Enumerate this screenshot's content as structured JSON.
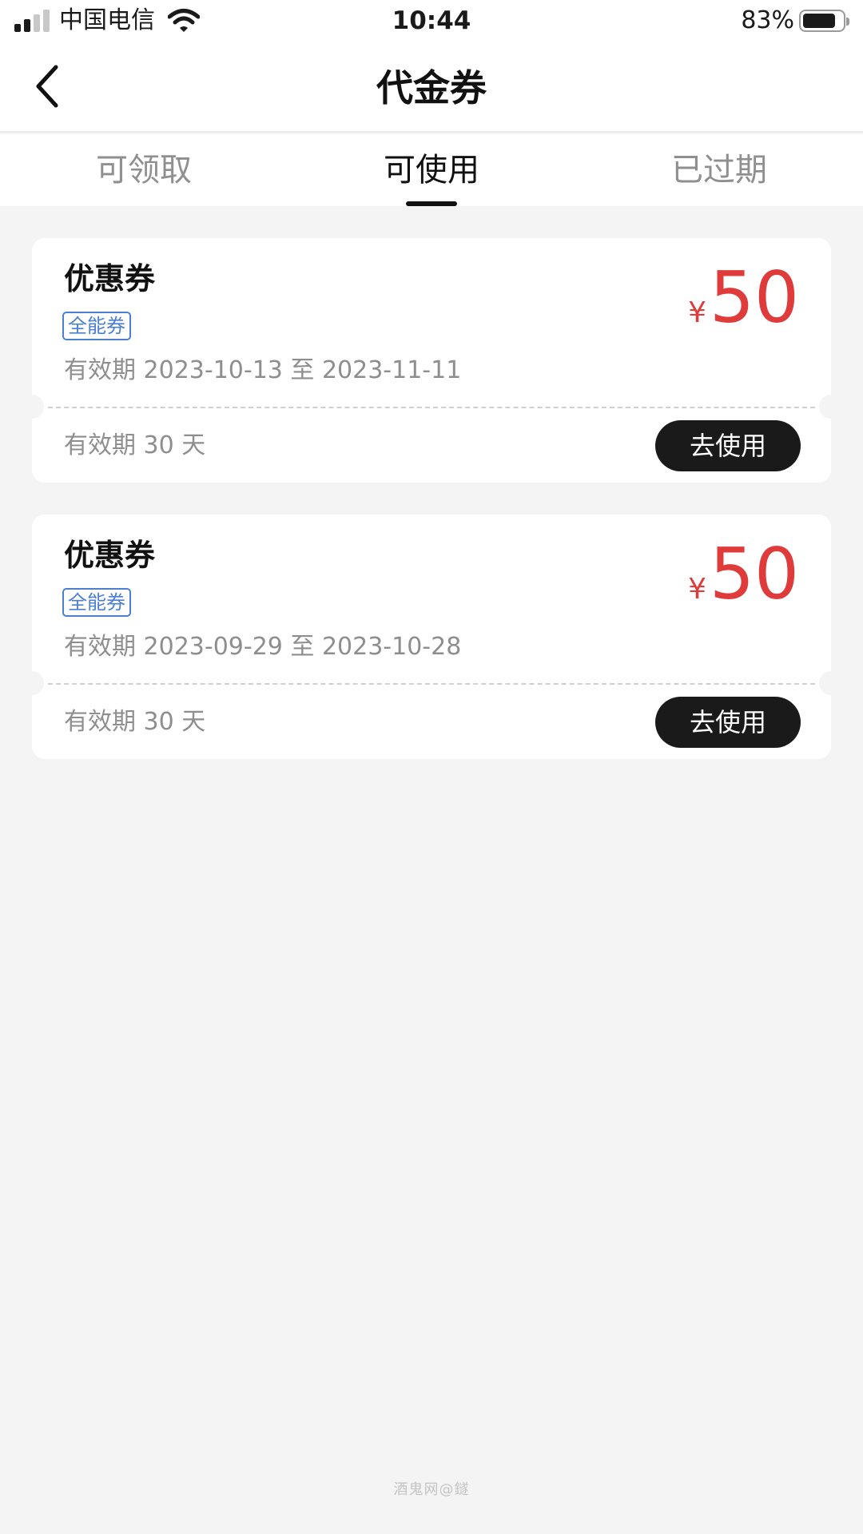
{
  "status_bar": {
    "carrier": "中国电信",
    "time": "10:44",
    "battery_percent": "83%",
    "battery_level": 0.83,
    "signal_bars_filled": 2,
    "signal_bars_total": 4
  },
  "nav": {
    "title": "代金券",
    "back_icon": "chevron-left-icon"
  },
  "tabs": [
    {
      "label": "可领取",
      "active": false
    },
    {
      "label": "可使用",
      "active": true
    },
    {
      "label": "已过期",
      "active": false
    }
  ],
  "coupons": [
    {
      "name": "优惠券",
      "tag": "全能券",
      "date_range": "有效期 2023-10-13 至 2023-11-11",
      "currency": "¥",
      "amount": "50",
      "validity": "有效期 30 天",
      "action_label": "去使用"
    },
    {
      "name": "优惠券",
      "tag": "全能券",
      "date_range": "有效期 2023-09-29 至 2023-10-28",
      "currency": "¥",
      "amount": "50",
      "validity": "有效期 30 天",
      "action_label": "去使用"
    }
  ],
  "watermark": "酒鬼网@鐩",
  "colors": {
    "accent_red": "#e03b3b",
    "tag_blue": "#4a7fd4",
    "button_dark": "#1a1a1a",
    "page_background": "#f4f4f4"
  }
}
